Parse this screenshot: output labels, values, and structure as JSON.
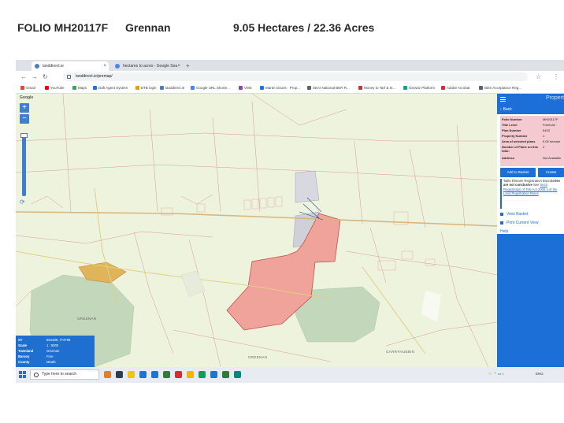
{
  "header": {
    "folio": "FOLIO MH20117F",
    "townland": "Grennan",
    "area": "9.05 Hectares  /  22.36 Acres"
  },
  "browser": {
    "tabs": [
      {
        "label": "landdirect.ie",
        "active": true
      },
      {
        "label": "hectares to acres - Google Sea",
        "active": false
      }
    ],
    "new_tab": "+",
    "url": "landdirect.ie/premap/",
    "bookmarks": [
      {
        "label": "Gmail",
        "color": "#ea4335"
      },
      {
        "label": "YouTube",
        "color": "#ff0000"
      },
      {
        "label": "Maps",
        "color": "#34a853"
      },
      {
        "label": "Daft Agent System",
        "color": "#1a73e8"
      },
      {
        "label": "BTB login",
        "color": "#f29900"
      },
      {
        "label": "landdirect.ie",
        "color": "#4a7fc1"
      },
      {
        "label": "Google URL Shorte...",
        "color": "#4285f4"
      },
      {
        "label": "VMS",
        "color": "#8e44ad"
      },
      {
        "label": "Martin Douris · Prop...",
        "color": "#1a73e8"
      },
      {
        "label": "SEAI National BER R...",
        "color": "#5f6368"
      },
      {
        "label": "Money to Tarf & In...",
        "color": "#c0392b"
      },
      {
        "label": "Geowiz Platform",
        "color": "#16a085"
      },
      {
        "label": "Adobe Acrobat",
        "color": "#d32f2f"
      },
      {
        "label": "BDS Acceptance Reg...",
        "color": "#5f6368"
      }
    ]
  },
  "map": {
    "brand": "Google",
    "zoom_in": "+",
    "zoom_out": "−",
    "labels": [
      {
        "text": "GREENAN"
      },
      {
        "text": "GREENAN"
      },
      {
        "text": "GARRYHUBBIN"
      }
    ],
    "info": {
      "xy_label": "XY",
      "xy_value": "654189, 774798",
      "scale_label": "Scale",
      "scale_value": "1 : 5000",
      "townland_label": "Townland",
      "townland_value": "Grennan",
      "barony_label": "Barony",
      "barony_value": "Fore",
      "county_label": "County",
      "county_value": "Meath"
    }
  },
  "panel": {
    "title": "Propert",
    "back": "Back",
    "rows": [
      {
        "k": "Folio Number",
        "v": "MH20117F"
      },
      {
        "k": "Title Level",
        "v": "Freehold"
      },
      {
        "k": "Plan Number",
        "v": "5403"
      },
      {
        "k": "Property Number",
        "v": "1"
      },
      {
        "k": "Area of selected plans",
        "v": "9.05 hectare"
      },
      {
        "k": "Number of Plans on this folio:",
        "v": "2"
      },
      {
        "k": "Address",
        "v": "Not Available"
      }
    ],
    "add_to_basket": "Add to Basket",
    "create": "Create",
    "notice_pre": "Tailte Éireann Registration Bounda",
    "notice_bold": "ries are not conclusive",
    "notice_mid": " See ",
    "notice_link": "Secti Registration of Title Act 2006 a of the Land Registration Rules",
    "view_basket": "View Basket",
    "print_view": "Print Current View",
    "help": "Help"
  },
  "taskbar": {
    "search": "Type here to search",
    "tray_lang": "ENG",
    "app_colors": [
      "#e67e22",
      "#2c3e50",
      "#f1c40f",
      "#1976d2",
      "#1976d2",
      "#2e7d32",
      "#d32f2f",
      "#f4b400",
      "#0f9d58",
      "#1976d2",
      "#2e7d32",
      "#00897b"
    ]
  },
  "colors": {
    "accent": "#1b6fd6",
    "selected_parcel": "#f0a39b",
    "neighbour_parcel": "#d0d0d8",
    "forest": "#c3d7ba",
    "map_bg": "#eef3de"
  }
}
